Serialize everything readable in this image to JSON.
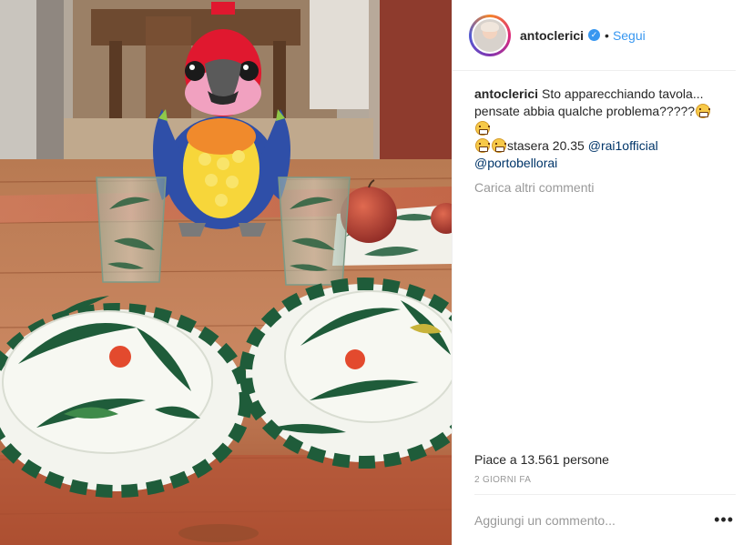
{
  "post": {
    "photo": {
      "description": "",
      "palette": {
        "wall": "#c9c5be",
        "floor": "#8a6a48",
        "table_dark": "#7a3d24",
        "table_light": "#c98660",
        "tablecloth": "#d9785f",
        "plate_rim_green": "#1f5c3a",
        "plate_white": "#f3f4ee",
        "parrot_red": "#e0182f",
        "parrot_blue": "#2f4fa8",
        "parrot_yellow": "#f7d63a",
        "apple": "#b83a33"
      }
    },
    "header": {
      "username": "antoclerici",
      "verified": true,
      "separator": "•",
      "follow_label": "Segui"
    },
    "caption": {
      "username": "antoclerici",
      "line1": "Sto apparecchiando tavola...",
      "line2": "pensate abbia qualche problema?????",
      "line3_text": "stasera 20.35",
      "mention1": "@rai1official",
      "mention2": "@portobellorai",
      "emoji": "grimacing-face-icon"
    },
    "load_more_label": "Carica altri commenti",
    "likes_text": "Piace a 13.561 persone",
    "date_text": "2 GIORNI FA",
    "comment_input": {
      "placeholder": "Aggiungi un commento...",
      "value": ""
    },
    "more_options_label": "•••",
    "colors": {
      "accent": "#3897f0",
      "link": "#003569",
      "muted": "#999999",
      "divider": "#efefef"
    }
  }
}
